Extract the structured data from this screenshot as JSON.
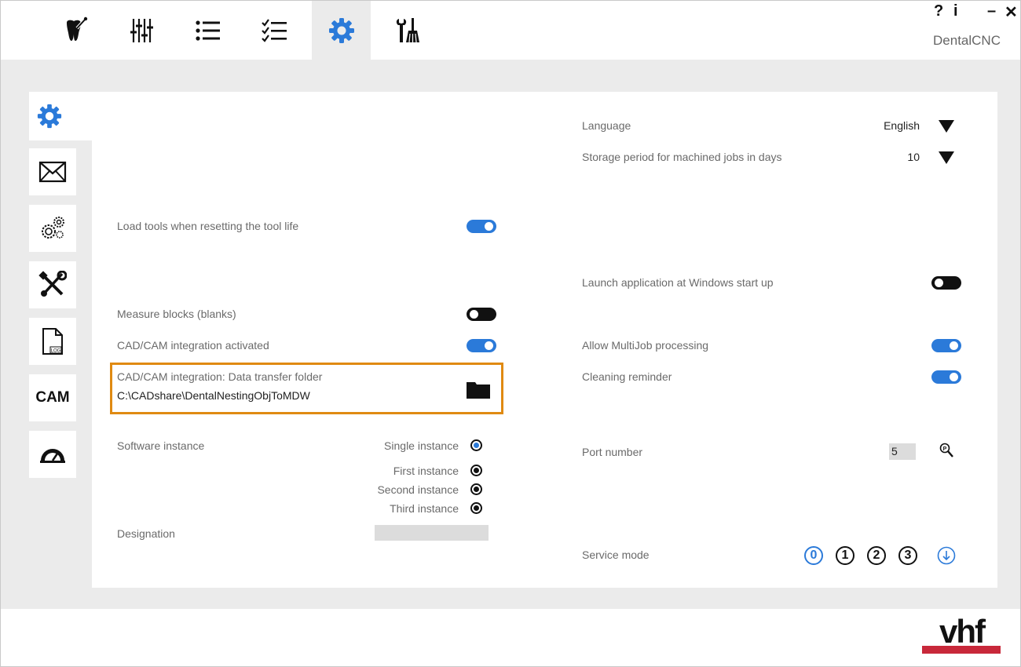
{
  "app": {
    "title": "DentalCNC",
    "help_label": "?",
    "info_label": "i",
    "minimize_label": "–",
    "close_label": "✕"
  },
  "top_tabs": [
    {
      "icon": "tooth-icon",
      "active": false
    },
    {
      "icon": "sliders-icon",
      "active": false
    },
    {
      "icon": "list-icon",
      "active": false
    },
    {
      "icon": "checklist-icon",
      "active": false
    },
    {
      "icon": "gear-icon",
      "active": true
    },
    {
      "icon": "tools-broom-icon",
      "active": false
    }
  ],
  "side_nav": [
    {
      "icon": "gear-icon",
      "active": true
    },
    {
      "icon": "envelope-icon",
      "active": false
    },
    {
      "icon": "gears-icon",
      "active": false
    },
    {
      "icon": "wrench-screwdriver-icon",
      "active": false
    },
    {
      "icon": "log-file-icon",
      "label": "LOG",
      "active": false
    },
    {
      "icon": "cam-icon",
      "label": "CAM",
      "active": false
    },
    {
      "icon": "gauge-icon",
      "active": false
    }
  ],
  "settings_left": {
    "load_tools": {
      "label": "Load tools when resetting the tool life",
      "on": true
    },
    "measure_blocks": {
      "label": "Measure blocks (blanks)",
      "on": false
    },
    "cadcam_active": {
      "label": "CAD/CAM integration activated",
      "on": true
    },
    "transfer_folder": {
      "label": "CAD/CAM integration: Data transfer folder",
      "value": "C:\\CADshare\\DentalNestingObjToMDW"
    },
    "software_instance": {
      "label": "Software instance",
      "options": [
        "Single instance",
        "First instance",
        "Second instance",
        "Third instance"
      ],
      "selected": "Single instance"
    },
    "designation": {
      "label": "Designation",
      "value": ""
    }
  },
  "settings_right": {
    "language": {
      "label": "Language",
      "value": "English"
    },
    "storage_period": {
      "label": "Storage period for machined jobs in days",
      "value": "10"
    },
    "launch_startup": {
      "label": "Launch application at Windows start up",
      "on": false
    },
    "multijob": {
      "label": "Allow MultiJob processing",
      "on": true
    },
    "cleaning": {
      "label": "Cleaning reminder",
      "on": true
    },
    "port": {
      "label": "Port number",
      "value": "5"
    },
    "service_mode": {
      "label": "Service mode",
      "options": [
        "0",
        "1",
        "2",
        "3"
      ],
      "selected": "0"
    }
  },
  "brand": {
    "logo_text": "vhf",
    "accent": "#c8283a",
    "toggle_on_color": "#2b7ad9",
    "highlight_color": "#e08a12"
  }
}
